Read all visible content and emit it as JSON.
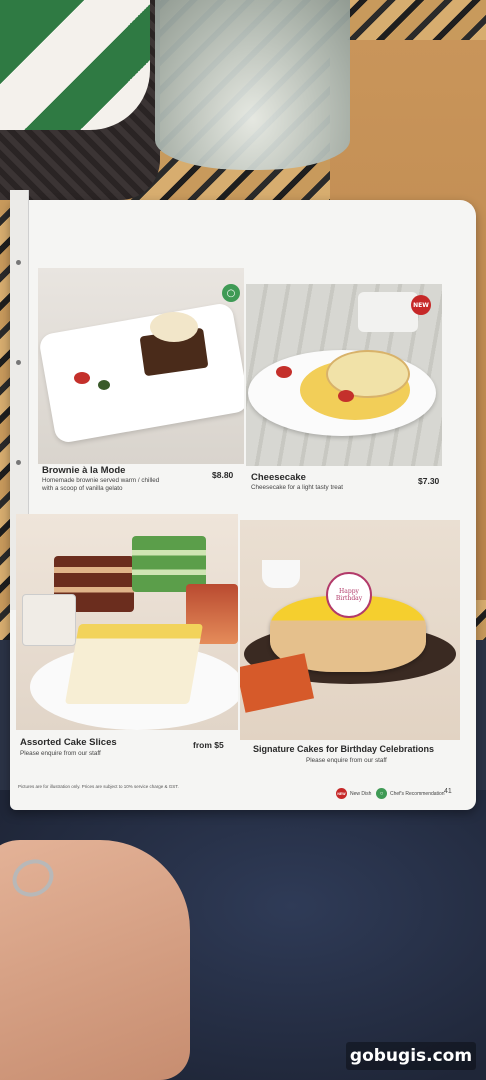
{
  "menu": {
    "dishes": [
      {
        "title": "Brownie à la Mode",
        "description_lines": [
          "Homemade brownie served warm / chilled",
          "with a scoop of vanilla gelato"
        ],
        "price": "$8.80",
        "badge": "chef-recommendation-icon"
      },
      {
        "title": "Cheesecake",
        "description_lines": [
          "Cheesecake for a light tasty treat"
        ],
        "price": "$7.30",
        "badge": "NEW"
      },
      {
        "title": "Assorted Cake Slices",
        "description_lines": [
          "Please enquire from our staff"
        ],
        "price": "from $5",
        "badge": ""
      },
      {
        "title": "Signature Cakes for Birthday Celebrations",
        "description_lines": [
          "Please enquire from our staff"
        ],
        "price": "",
        "badge": ""
      }
    ],
    "footer_note": "Pictures are for illustration only. Prices are subject to 10% service charge & GST.",
    "legend": {
      "new_badge": "NEW",
      "new_label": "New Dish",
      "chef_label": "Chef's Recommendation"
    },
    "page_number": "41",
    "cake_topper": "Happy Birthday"
  },
  "watermark": "gobugis.com",
  "colors": {
    "page": "#f5f5f3",
    "new_badge": "#c62828",
    "chef_badge": "#3f9a55"
  }
}
